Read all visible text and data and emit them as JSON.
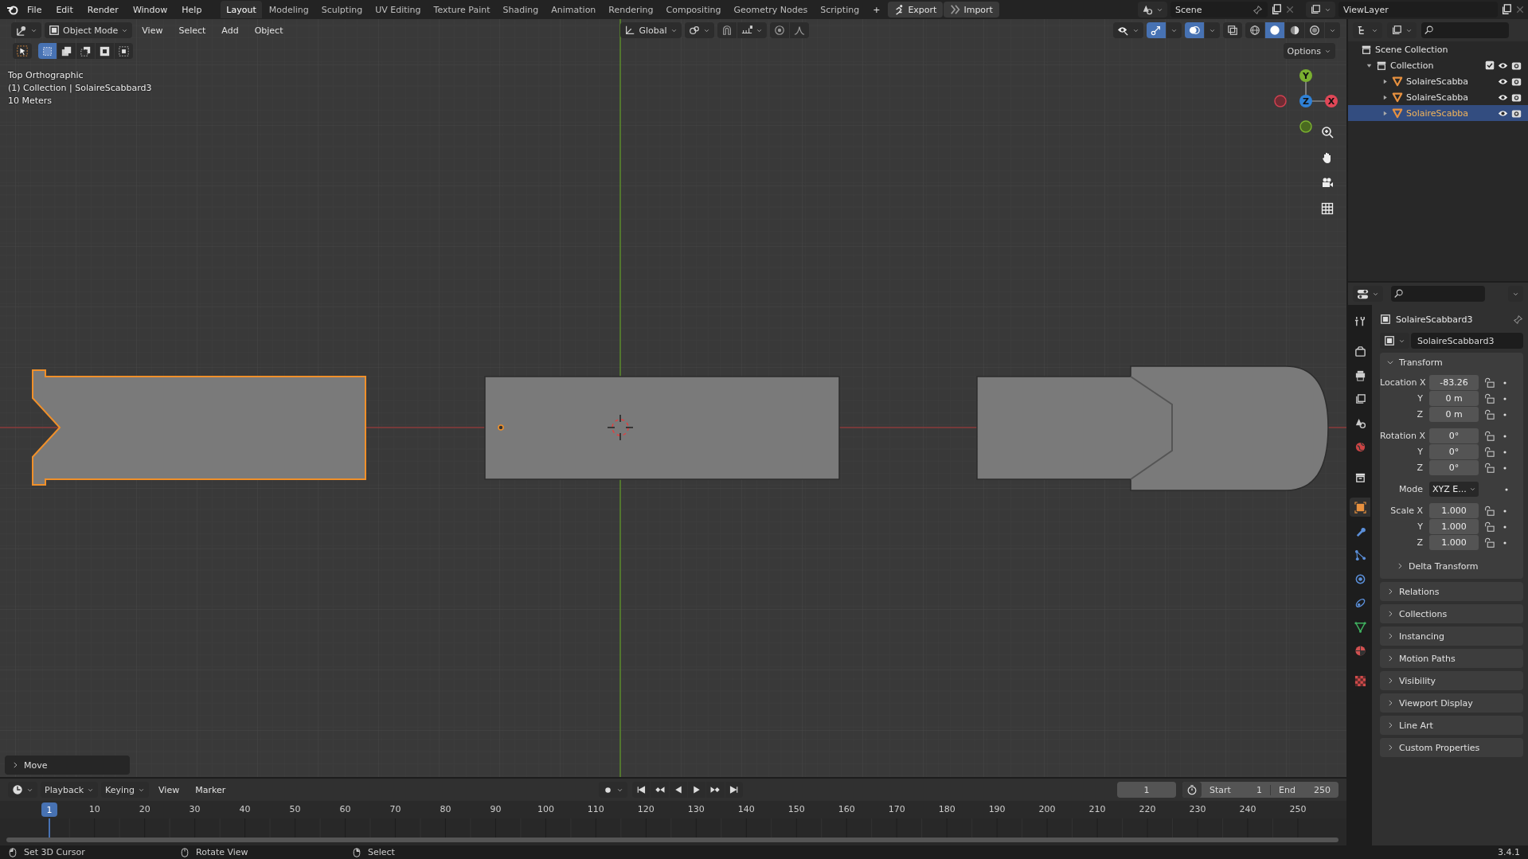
{
  "top_bar": {
    "menus": [
      "File",
      "Edit",
      "Render",
      "Window",
      "Help"
    ],
    "workspaces": [
      {
        "label": "Layout",
        "selected": true
      },
      {
        "label": "Modeling",
        "selected": false
      },
      {
        "label": "Sculpting",
        "selected": false
      },
      {
        "label": "UV Editing",
        "selected": false
      },
      {
        "label": "Texture Paint",
        "selected": false
      },
      {
        "label": "Shading",
        "selected": false
      },
      {
        "label": "Animation",
        "selected": false
      },
      {
        "label": "Rendering",
        "selected": false
      },
      {
        "label": "Compositing",
        "selected": false
      },
      {
        "label": "Geometry Nodes",
        "selected": false
      },
      {
        "label": "Scripting",
        "selected": false
      }
    ],
    "add_workspace": "+",
    "export": "Export",
    "import": "Import",
    "scene": "Scene",
    "view_layer": "ViewLayer"
  },
  "viewport": {
    "mode": "Object Mode",
    "menus": [
      "View",
      "Select",
      "Add",
      "Object"
    ],
    "orientation": "Global",
    "options": "Options",
    "info": [
      "Top Orthographic",
      "(1) Collection | SolaireScabbard3",
      "10 Meters"
    ],
    "gizmo": {
      "x": "X",
      "y": "Y",
      "z": "Z"
    },
    "objects": [
      {
        "kind": "notched",
        "selected": true
      },
      {
        "kind": "plain",
        "selected": false
      },
      {
        "kind": "capped",
        "selected": false
      }
    ],
    "last_operator": "Move"
  },
  "outliner": {
    "root": "Scene Collection",
    "collections": [
      {
        "name": "Collection",
        "expanded": true,
        "checked": true,
        "children": [
          {
            "name": "SolaireScabba",
            "selected": false
          },
          {
            "name": "SolaireScabba",
            "selected": false
          },
          {
            "name": "SolaireScabba",
            "selected": true
          }
        ]
      }
    ]
  },
  "properties": {
    "tabs": [
      {
        "kind": "tool",
        "selected": false
      },
      {
        "kind": "render",
        "selected": false
      },
      {
        "kind": "output",
        "selected": false
      },
      {
        "kind": "view_layer",
        "selected": false
      },
      {
        "kind": "scene",
        "selected": false
      },
      {
        "kind": "world",
        "selected": false
      },
      {
        "kind": "collection",
        "selected": false
      },
      {
        "kind": "object",
        "selected": true
      },
      {
        "kind": "modifiers",
        "selected": false
      },
      {
        "kind": "particles",
        "selected": false
      },
      {
        "kind": "physics",
        "selected": false
      },
      {
        "kind": "constraints",
        "selected": false
      },
      {
        "kind": "data",
        "selected": false
      },
      {
        "kind": "material",
        "selected": false
      },
      {
        "kind": "texture",
        "selected": false
      }
    ],
    "object_name": "SolaireScabbard3",
    "data_name": "SolaireScabbard3",
    "transform": {
      "title": "Transform",
      "expanded": true,
      "groups": [
        [
          {
            "label": "Location X",
            "value": "-83.26",
            "kind": "field"
          },
          {
            "label": "Y",
            "value": "0 m",
            "kind": "field"
          },
          {
            "label": "Z",
            "value": "0 m",
            "kind": "field"
          }
        ],
        [
          {
            "label": "Rotation X",
            "value": "0°",
            "kind": "field"
          },
          {
            "label": "Y",
            "value": "0°",
            "kind": "field"
          },
          {
            "label": "Z",
            "value": "0°",
            "kind": "field"
          }
        ],
        [
          {
            "label": "Mode",
            "value": "XYZ E...",
            "kind": "dropdown"
          }
        ],
        [
          {
            "label": "Scale X",
            "value": "1.000",
            "kind": "field"
          },
          {
            "label": "Y",
            "value": "1.000",
            "kind": "field"
          },
          {
            "label": "Z",
            "value": "1.000",
            "kind": "field"
          }
        ]
      ],
      "subpanel": {
        "title": "Delta Transform",
        "expanded": false
      }
    },
    "sections": [
      {
        "title": "Relations",
        "expanded": false
      },
      {
        "title": "Collections",
        "expanded": false
      },
      {
        "title": "Instancing",
        "expanded": false
      },
      {
        "title": "Motion Paths",
        "expanded": false
      },
      {
        "title": "Visibility",
        "expanded": false
      },
      {
        "title": "Viewport Display",
        "expanded": false
      },
      {
        "title": "Line Art",
        "expanded": false
      },
      {
        "title": "Custom Properties",
        "expanded": false
      }
    ]
  },
  "timeline": {
    "menus": [
      "Playback",
      "Keying",
      "View",
      "Marker"
    ],
    "current_frame": "1",
    "start_label": "Start",
    "start": "1",
    "end_label": "End",
    "end": "250",
    "playhead": "1",
    "ticks": [
      "10",
      "20",
      "30",
      "40",
      "50",
      "60",
      "70",
      "80",
      "90",
      "100",
      "110",
      "120",
      "130",
      "140",
      "150",
      "160",
      "170",
      "180",
      "190",
      "200",
      "210",
      "220",
      "230",
      "240",
      "250"
    ]
  },
  "status_bar": {
    "hints": [
      "Set 3D Cursor",
      "Rotate View",
      "Select"
    ],
    "version": "3.4.1"
  }
}
